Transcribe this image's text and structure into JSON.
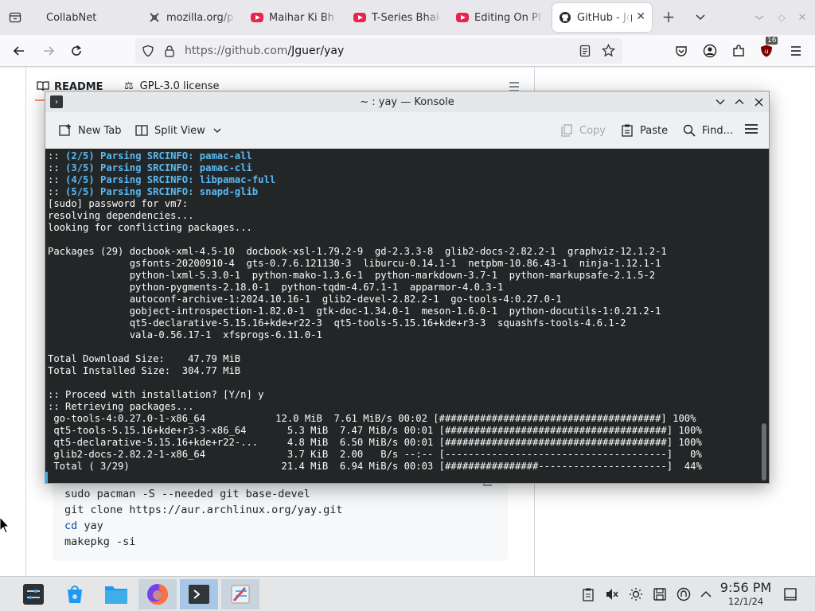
{
  "browser": {
    "tabs": [
      {
        "label": "CollabNet",
        "icon": "tab-list-icon"
      },
      {
        "label": "mozilla.org/p",
        "icon": "mozilla-icon"
      },
      {
        "label": "Maihar Ki Bh",
        "icon": "youtube-icon"
      },
      {
        "label": "T-Series Bhak",
        "icon": "youtube-icon"
      },
      {
        "label": "Editing On PI",
        "icon": "youtube-icon"
      },
      {
        "label": "GitHub - Jg",
        "icon": "github-icon",
        "active": true
      }
    ],
    "url_host": "https://github.com",
    "url_path": "/Jguer/yay",
    "extensions_badge": "16"
  },
  "github": {
    "readme_tab": "README",
    "license_tab": "GPL-3.0 license",
    "code_lines": [
      {
        "cmd": "sudo pacman -S --needed git base-devel"
      },
      {
        "cmd": "git clone https://aur.archlinux.org/yay.git"
      },
      {
        "kw": "cd",
        "rest": " yay"
      },
      {
        "cmd": "makepkg -si"
      }
    ]
  },
  "konsole": {
    "title": "~ : yay — Konsole",
    "toolbar": {
      "new_tab": "New Tab",
      "split_view": "Split View",
      "copy": "Copy",
      "paste": "Paste",
      "find": "Find..."
    },
    "terminal_lines": [
      {
        "text": ":: (2/5) Parsing SRCINFO: pamac-all",
        "style": "blue"
      },
      {
        "text": ":: (3/5) Parsing SRCINFO: pamac-cli",
        "style": "blue"
      },
      {
        "text": ":: (4/5) Parsing SRCINFO: libpamac-full",
        "style": "blue"
      },
      {
        "text": ":: (5/5) Parsing SRCINFO: snapd-glib",
        "style": "blue"
      },
      {
        "text": "[sudo] password for vm7:"
      },
      {
        "text": "resolving dependencies..."
      },
      {
        "text": "looking for conflicting packages..."
      },
      {
        "text": ""
      },
      {
        "text": "Packages (29) docbook-xml-4.5-10  docbook-xsl-1.79.2-9  gd-2.3.3-8  glib2-docs-2.82.2-1  graphviz-12.1.2-1"
      },
      {
        "text": "              gsfonts-20200910-4  gts-0.7.6.121130-3  liburcu-0.14.1-1  netpbm-10.86.43-1  ninja-1.12.1-1"
      },
      {
        "text": "              python-lxml-5.3.0-1  python-mako-1.3.6-1  python-markdown-3.7-1  python-markupsafe-2.1.5-2"
      },
      {
        "text": "              python-pygments-2.18.0-1  python-tqdm-4.67.1-1  apparmor-4.0.3-1"
      },
      {
        "text": "              autoconf-archive-1:2024.10.16-1  glib2-devel-2.82.2-1  go-tools-4:0.27.0-1"
      },
      {
        "text": "              gobject-introspection-1.82.0-1  gtk-doc-1.34.0-1  meson-1.6.0-1  python-docutils-1:0.21.2-1"
      },
      {
        "text": "              qt5-declarative-5.15.16+kde+r22-3  qt5-tools-5.15.16+kde+r3-3  squashfs-tools-4.6.1-2"
      },
      {
        "text": "              vala-0.56.17-1  xfsprogs-6.11.0-1"
      },
      {
        "text": ""
      },
      {
        "text": "Total Download Size:    47.79 MiB"
      },
      {
        "text": "Total Installed Size:  304.77 MiB"
      },
      {
        "text": ""
      },
      {
        "text": ":: Proceed with installation? [Y/n] y"
      },
      {
        "text": ":: Retrieving packages..."
      },
      {
        "text": " go-tools-4:0.27.0-1-x86_64            12.0 MiB  7.61 MiB/s 00:02 [######################################] 100%"
      },
      {
        "text": " qt5-tools-5.15.16+kde+r3-3-x86_64       5.3 MiB  7.47 MiB/s 00:01 [######################################] 100%"
      },
      {
        "text": " qt5-declarative-5.15.16+kde+r22-...     4.8 MiB  6.50 MiB/s 00:01 [######################################] 100%"
      },
      {
        "text": " glib2-docs-2.82.2-1-x86_64              3.7 KiB  2.00   B/s --:-- [--------------------------------------]   0%"
      },
      {
        "text": " Total ( 3/29)                          21.4 MiB  6.94 MiB/s 00:03 [################----------------------]  44%"
      }
    ]
  },
  "taskbar": {
    "apps": [
      {
        "name": "application-launcher-icon"
      },
      {
        "name": "discover-icon"
      },
      {
        "name": "dolphin-icon"
      },
      {
        "name": "firefox-icon"
      },
      {
        "name": "konsole-icon"
      },
      {
        "name": "kate-icon"
      }
    ],
    "clock_time": "9:56 PM",
    "clock_date": "12/1/24"
  },
  "colors": {
    "terminal_bg": "#232627",
    "terminal_blue": "#5bb9f2",
    "selection_blue": "#3daee9",
    "youtube_red": "#e8244a"
  }
}
